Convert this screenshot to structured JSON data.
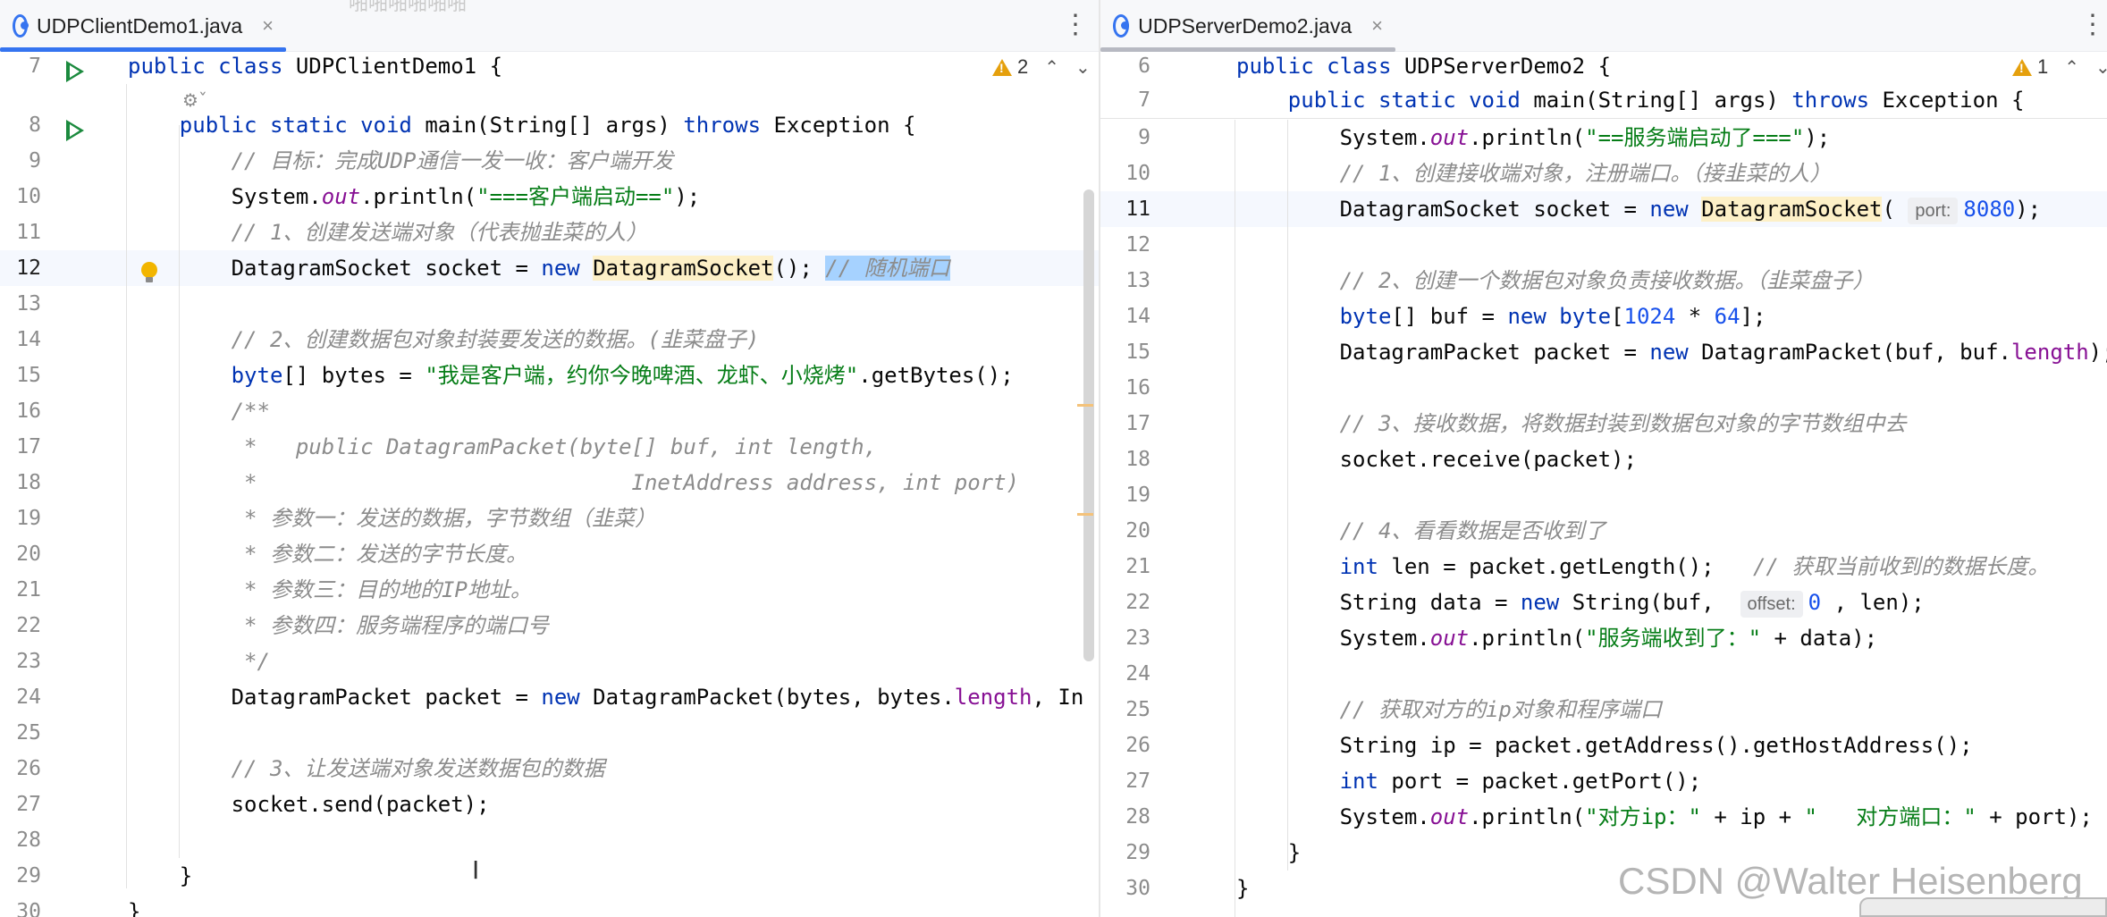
{
  "left": {
    "tab": {
      "label": "UDPClientDemo1.java",
      "close": "×",
      "icon": "java-class-icon"
    },
    "ghost_text": "啪啪啪啪啪啪",
    "warnings": {
      "count": "2"
    },
    "lines": [
      {
        "n": "7",
        "html": "<span class=\"kw\">public class</span> UDPClientDemo1 {"
      },
      {
        "n": "",
        "html": ""
      },
      {
        "n": "8",
        "html": "    <span class=\"kw\">public static void</span> main(String[] args) <span class=\"kw\">throws</span> Exception {"
      },
      {
        "n": "9",
        "html": "        <span class=\"cmt\">// 目标：完成UDP通信一发一收：客户端开发</span>"
      },
      {
        "n": "10",
        "html": "        System.<span class=\"fld\">out</span>.println(<span class=\"str\">\"===客户端启动==\"</span>);"
      },
      {
        "n": "11",
        "html": "        <span class=\"cmt\">// 1、创建发送端对象（代表抛韭菜的人）</span>"
      },
      {
        "n": "12",
        "html": "        DatagramSocket socket = <span class=\"kw\">new</span> <span class=\"cls-hl\">DatagramSock</span><span class=\"cls-hl\">et</span>(); <span class=\"sel\"><span class=\"cmt\">// 随机端口</span></span>"
      },
      {
        "n": "13",
        "html": ""
      },
      {
        "n": "14",
        "html": "        <span class=\"cmt\">// 2、创建数据包对象封装要发送的数据。(韭菜盘子)</span>"
      },
      {
        "n": "15",
        "html": "        <span class=\"kw\">byte</span>[] bytes = <span class=\"str\">\"我是客户端，约你今晚啤酒、龙虾、小烧烤\"</span>.getBytes();"
      },
      {
        "n": "16",
        "html": "        <span class=\"cmt\">/**</span>"
      },
      {
        "n": "17",
        "html": "<span class=\"cmt\">         *   public DatagramPacket(byte[] buf, int length,</span>"
      },
      {
        "n": "18",
        "html": "<span class=\"cmt\">         *                             InetAddress address, int port)</span>"
      },
      {
        "n": "19",
        "html": "<span class=\"cmt\">         * 参数一：发送的数据，字节数组（韭菜）</span>"
      },
      {
        "n": "20",
        "html": "<span class=\"cmt\">         * 参数二：发送的字节长度。</span>"
      },
      {
        "n": "21",
        "html": "<span class=\"cmt\">         * 参数三：目的地的IP地址。</span>"
      },
      {
        "n": "22",
        "html": "<span class=\"cmt\">         * 参数四：服务端程序的端口号</span>"
      },
      {
        "n": "23",
        "html": "<span class=\"cmt\">         */</span>"
      },
      {
        "n": "24",
        "html": "        DatagramPacket packet = <span class=\"kw\">new</span> DatagramPacket(bytes, bytes.<span class=\"prop\">length</span>, In"
      },
      {
        "n": "25",
        "html": ""
      },
      {
        "n": "26",
        "html": "        <span class=\"cmt\">// 3、让发送端对象发送数据包的数据</span>"
      },
      {
        "n": "27",
        "html": "        socket.send(packet);"
      },
      {
        "n": "28",
        "html": ""
      },
      {
        "n": "29",
        "html": "    }"
      },
      {
        "n": "30",
        "html": "}"
      }
    ]
  },
  "right": {
    "tab": {
      "label": "UDPServerDemo2.java",
      "close": "×",
      "icon": "java-class-icon"
    },
    "warnings": {
      "count": "1"
    },
    "lines": [
      {
        "n": "6",
        "html": "<span class=\"kw\">public class</span> UDPServerDemo2 {"
      },
      {
        "n": "7",
        "html": "    <span class=\"kw\">public static void</span> main(String[] args) <span class=\"kw\">throws</span> Exception {"
      },
      {
        "n": "9",
        "html": "        System.<span class=\"fld\">out</span>.println(<span class=\"str\">\"==服务端启动了===\"</span>);"
      },
      {
        "n": "10",
        "html": "        <span class=\"cmt\">// 1、创建接收端对象，注册端口。（接韭菜的人）</span>"
      },
      {
        "n": "11",
        "html": "        DatagramSocket socket = <span class=\"kw\">new</span> <span class=\"cls-hl\">DatagramSocket</span>( <span class=\"hint\">port:</span><span class=\"num\">8080</span>);"
      },
      {
        "n": "12",
        "html": ""
      },
      {
        "n": "13",
        "html": "        <span class=\"cmt\">// 2、创建一个数据包对象负责接收数据。（韭菜盘子）</span>"
      },
      {
        "n": "14",
        "html": "        <span class=\"kw\">byte</span>[] buf = <span class=\"kw\">new</span> <span class=\"kw\">byte</span>[<span class=\"num\">1024</span> * <span class=\"num\">64</span>];"
      },
      {
        "n": "15",
        "html": "        DatagramPacket packet = <span class=\"kw\">new</span> DatagramPacket(buf, buf.<span class=\"prop\">length</span>);"
      },
      {
        "n": "16",
        "html": ""
      },
      {
        "n": "17",
        "html": "        <span class=\"cmt\">// 3、接收数据，将数据封装到数据包对象的字节数组中去</span>"
      },
      {
        "n": "18",
        "html": "        socket.receive(packet);"
      },
      {
        "n": "19",
        "html": ""
      },
      {
        "n": "20",
        "html": "        <span class=\"cmt\">// 4、看看数据是否收到了</span>"
      },
      {
        "n": "21",
        "html": "        <span class=\"kw\">int</span> len = packet.getLength();   <span class=\"cmt\">// 获取当前收到的数据长度。</span>"
      },
      {
        "n": "22",
        "html": "        String data = <span class=\"kw\">new</span> String(buf,  <span class=\"hint\">offset:</span><span class=\"num\">0</span> , len);"
      },
      {
        "n": "23",
        "html": "        System.<span class=\"fld\">out</span>.println(<span class=\"str\">\"服务端收到了：\"</span> + data);"
      },
      {
        "n": "24",
        "html": ""
      },
      {
        "n": "25",
        "html": "        <span class=\"cmt\">// 获取对方的ip对象和程序端口</span>"
      },
      {
        "n": "26",
        "html": "        String ip = packet.getAddress().getHostAddress();"
      },
      {
        "n": "27",
        "html": "        <span class=\"kw\">int</span> port = packet.getPort();"
      },
      {
        "n": "28",
        "html": "        System.<span class=\"fld\">out</span>.println(<span class=\"str\">\"对方ip：\"</span> + ip + <span class=\"str\">\"   对方端口：\"</span> + port);"
      },
      {
        "n": "29",
        "html": "    }"
      },
      {
        "n": "30",
        "html": "}"
      }
    ]
  },
  "watermark": "CSDN @Walter Heisenberg",
  "colors": {
    "keyword": "#0033b3",
    "string": "#067d17",
    "comment": "#8c8c8c",
    "field": "#871094",
    "number": "#1750eb",
    "tab_accent": "#3574f0"
  }
}
